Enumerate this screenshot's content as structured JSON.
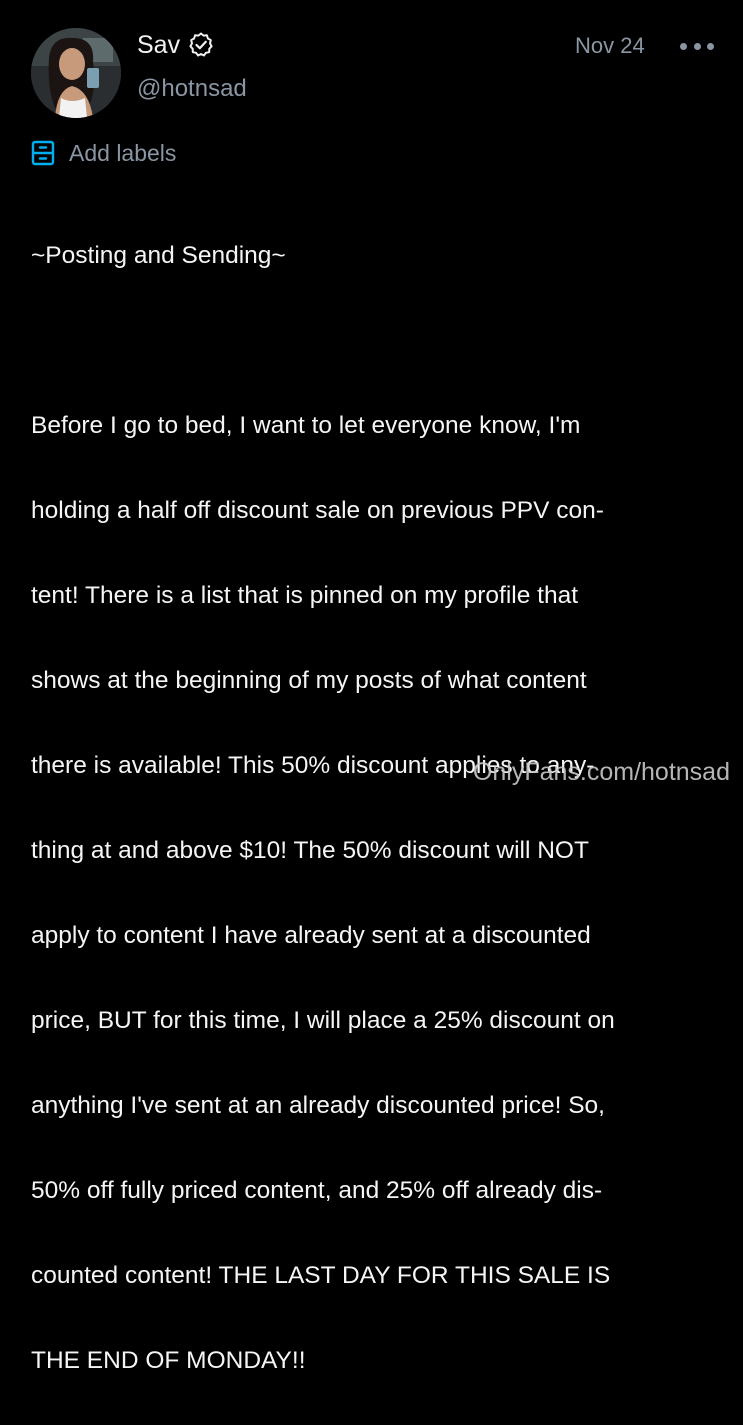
{
  "post": {
    "author": {
      "display_name": "Sav",
      "username": "@hotnsad",
      "verified": true
    },
    "date": "Nov 24",
    "labels_button": "Add labels",
    "text_lines": [
      "~Posting and Sending~",
      "",
      "Before I go to bed, I want to let everyone know, I'm",
      "holding a half off discount sale on previous PPV con-",
      "tent! There is a list that is pinned on my profile that",
      "shows at the beginning of my posts of what content",
      "there is available! This 50% discount applies to any-",
      "thing at and above $10! The 50% discount will NOT",
      "apply to content I have already sent at a discounted",
      "price, BUT for this time, I will place a 25% discount on",
      "anything I've sent at an already discounted price! So,",
      "50% off fully priced content, and 25% off already dis-",
      "counted content! THE LAST DAY FOR THIS SALE IS",
      "THE END OF MONDAY!!"
    ],
    "watermark": "OnlyFans.com/hotnsad"
  },
  "icons": {
    "verified": "verified-badge-icon",
    "more": "more-horizontal-icon",
    "labels": "labels-icon"
  },
  "colors": {
    "background": "#000000",
    "muted": "#8a96a3",
    "accent": "#00aff0",
    "text": "#f5f5f5"
  }
}
